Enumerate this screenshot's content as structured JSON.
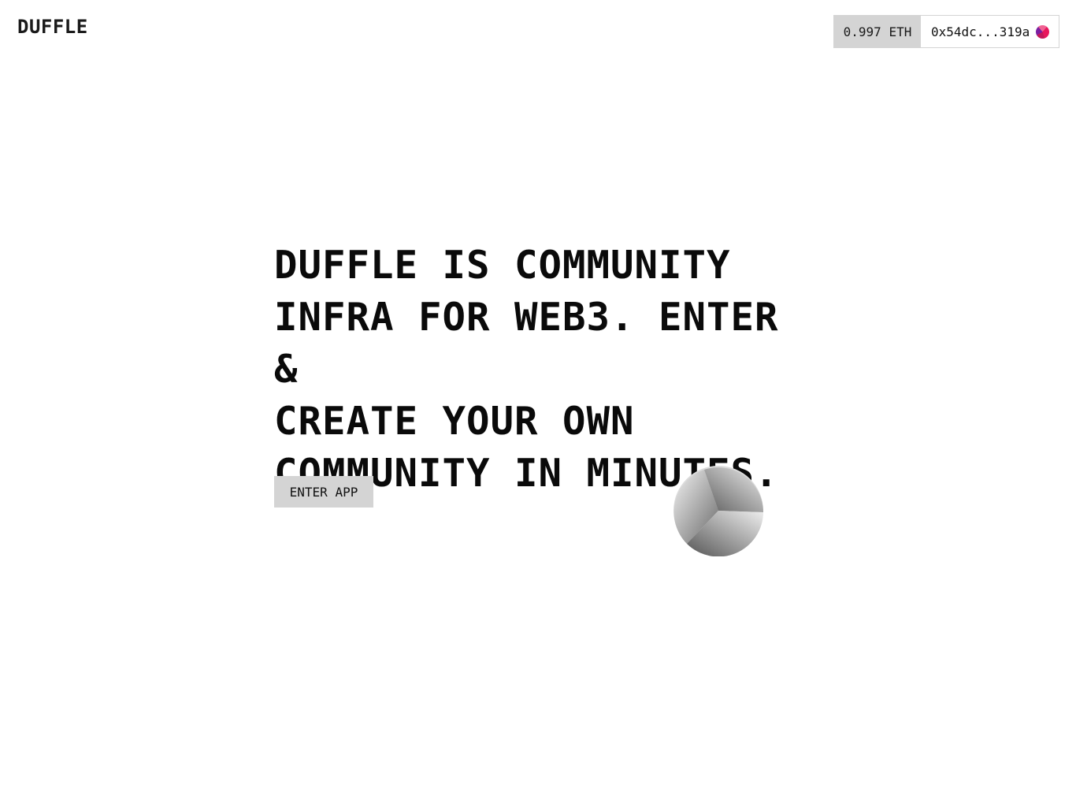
{
  "header": {
    "logo": "DUFFLE"
  },
  "wallet": {
    "balance": "0.997 ETH",
    "address": "0x54dc...319a",
    "avatar_icon": "wallet-avatar-icon",
    "avatar_color": "#e8175d"
  },
  "hero": {
    "headline": "DUFFLE IS COMMUNITY\nINFRA FOR WEB3. ENTER &\nCREATE YOUR OWN\nCOMMUNITY IN MINUTES.",
    "cta_label": "ENTER APP"
  },
  "colors": {
    "background": "#ffffff",
    "button_gray": "#d4d4d4",
    "text": "#111111"
  }
}
